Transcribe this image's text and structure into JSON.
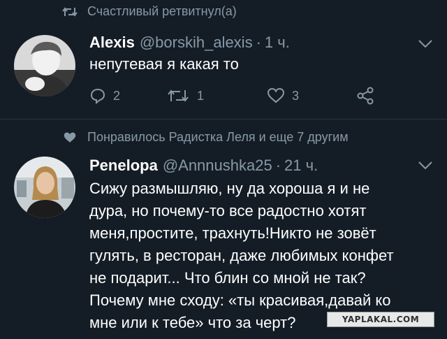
{
  "tweet1": {
    "context": "Счастливый ретвитнул(а)",
    "name": "Alexis",
    "handle": "@borskih_alexis",
    "separator": "·",
    "time": "1 ч.",
    "text": "непутевая я какая то",
    "replies": "2",
    "retweets": "1",
    "likes": "3"
  },
  "tweet2": {
    "context": "Понравилось Радистка Леля и еще 7 другим",
    "name": "Penelopa",
    "handle": "@Annnushka25",
    "separator": "·",
    "time": "21 ч.",
    "lines": [
      "Сижу размышляю, ну да хороша я и не",
      "дура, но почему-то все радостно хотят",
      "меня,простите, трахнуть!Никто не зовёт",
      "гулять, в ресторан, даже любимых конфет",
      "не подарит... Что блин со мной не так?",
      "Почему мне сходу: «ты красивая,давай ко",
      "мне или к тебе» что за черт?"
    ]
  },
  "watermark": "YAPLAKAL.COM",
  "colors": {
    "background": "#141d26",
    "secondary_text": "#8899a6",
    "divider": "#243447"
  }
}
